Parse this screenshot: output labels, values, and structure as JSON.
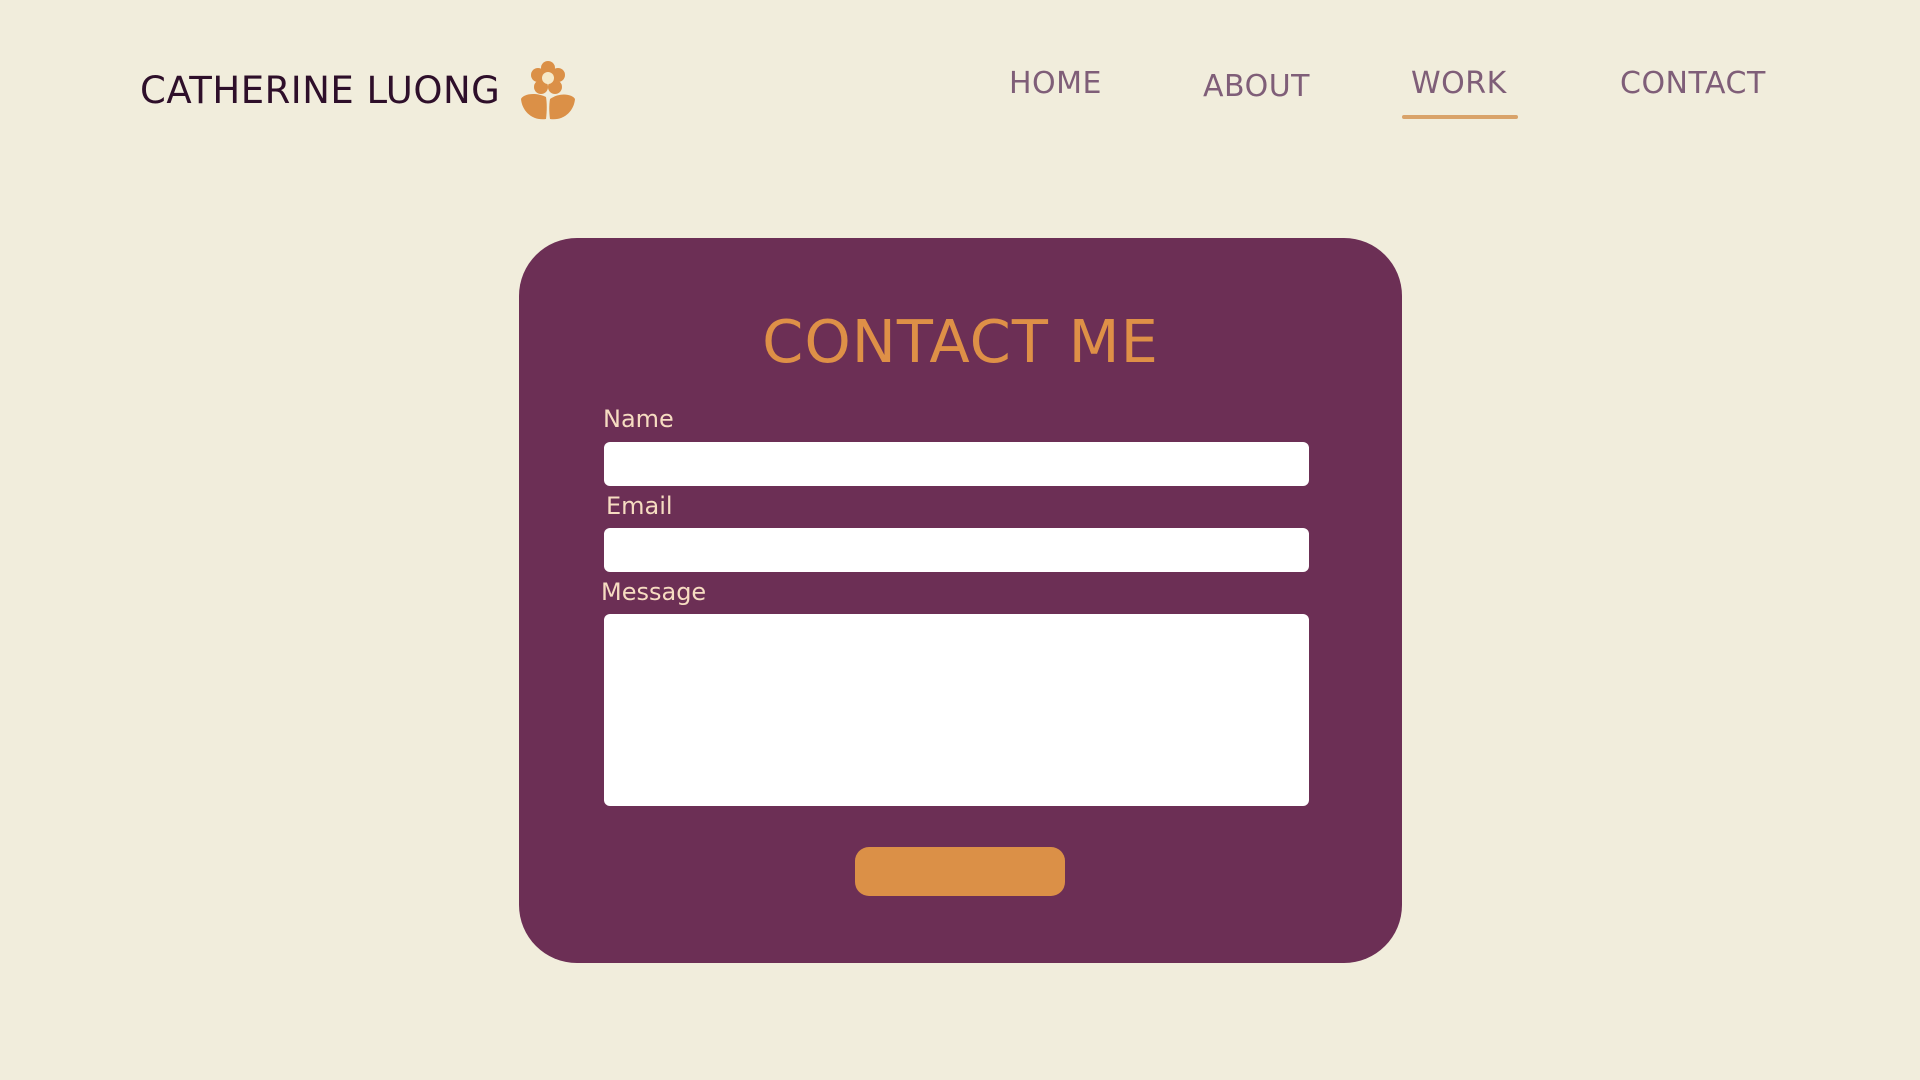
{
  "brand": {
    "name": "CATHERINE LUONG",
    "icon": "flower-icon"
  },
  "nav": {
    "items": [
      {
        "label": "HOME"
      },
      {
        "label": "ABOUT"
      },
      {
        "label": "WORK",
        "active": true
      },
      {
        "label": "CONTACT"
      }
    ]
  },
  "contact_form": {
    "title": "CONTACT ME",
    "name_label": "Name",
    "name_value": "",
    "email_label": "Email",
    "email_value": "",
    "message_label": "Message",
    "message_value": "",
    "submit_label": ""
  },
  "colors": {
    "background": "#f1eddc",
    "brand_text": "#2e0f2a",
    "nav_text": "#7f5e78",
    "accent": "#db9047",
    "card": "#6c2f55",
    "label_text": "#f6dcc1"
  }
}
